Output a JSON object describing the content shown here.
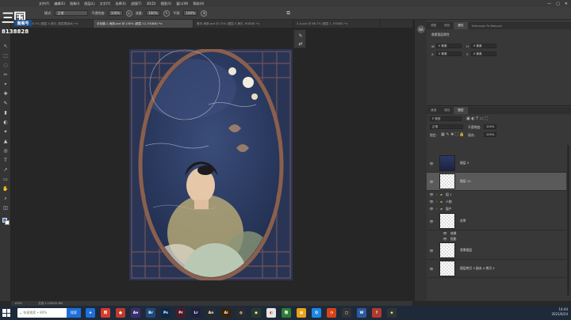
{
  "menu": [
    "文件(F)",
    "编辑(E)",
    "图像(I)",
    "图层(L)",
    "文字(Y)",
    "选择(S)",
    "滤镜(T)",
    "3D(D)",
    "视图(V)",
    "窗口(W)",
    "帮助(H)"
  ],
  "logo": {
    "mark": "三国",
    "sub": "南阁号",
    "number": "8138828"
  },
  "options": {
    "mode_label": "模式:",
    "mode_value": "正常",
    "opacity_label": "不透明度:",
    "opacity_value": "100%",
    "flow_label": "流量:",
    "flow_value": "100%",
    "smooth_label": "平滑:",
    "smooth_value": "100%"
  },
  "tabs": [
    {
      "label": "未标题-1 @ 16.7% (图层 4 拷贝, 图层蒙版/8) *",
      "active": false
    },
    {
      "label": "未标题-1-海报.psd @ 100% (图层 12, RGB/8) *",
      "active": true
    },
    {
      "label": "素材-海报.psd @ 25% (图层 0 拷贝, RGB/8) *",
      "active": false
    },
    {
      "label": "3-4.psd @ 66.7% (图层 1, RGB/8) *",
      "active": false
    }
  ],
  "status": {
    "zoom": "100%",
    "doc": "文档:1.22M/35.8M"
  },
  "panel": {
    "top_tabs": [
      "调整",
      "颜色",
      "属性",
      "Extension Ps Retouch"
    ],
    "top_active": "属性",
    "properties_title": "像素图层属性",
    "w_label": "W",
    "w_value": "0 像素",
    "h_label": "H",
    "h_value": "0 像素",
    "x_label": "X",
    "x_value": "0 像素",
    "y_label": "Y",
    "y_value": "0 像素",
    "layer_tabs": [
      "通道",
      "路径",
      "图层"
    ],
    "layer_active": "图层",
    "kind_label": "P 类型",
    "blend": "正常",
    "opacity_label": "不透明度:",
    "opacity_value": "100%",
    "lock_label": "锁定:",
    "fill_label": "填充:",
    "fill_value": "100%"
  },
  "layers": [
    {
      "name": "图层 3",
      "type": "photo",
      "selected": false
    },
    {
      "name": "图层 12",
      "type": "empty",
      "selected": true
    },
    {
      "name": "组 1",
      "type": "group"
    },
    {
      "name": "人物",
      "type": "group"
    },
    {
      "name": "窗户",
      "type": "group"
    },
    {
      "name": "花草",
      "type": "empty",
      "selected": false
    },
    {
      "name": "效果",
      "type": "fx"
    },
    {
      "name": "投影",
      "type": "fx"
    },
    {
      "name": "背景图层",
      "type": "empty",
      "selected": false
    },
    {
      "name": "图层拷贝 3 副本 4 拷贝 2",
      "type": "empty",
      "selected": false
    }
  ],
  "taskbar": {
    "search_placeholder": "快速搜索 • 80%",
    "search_button": "搜索",
    "time": "14:44",
    "date": "2021/6/24"
  },
  "colors": {
    "accent": "#1e6fd9",
    "canvas_bg": "#1f2a44"
  }
}
